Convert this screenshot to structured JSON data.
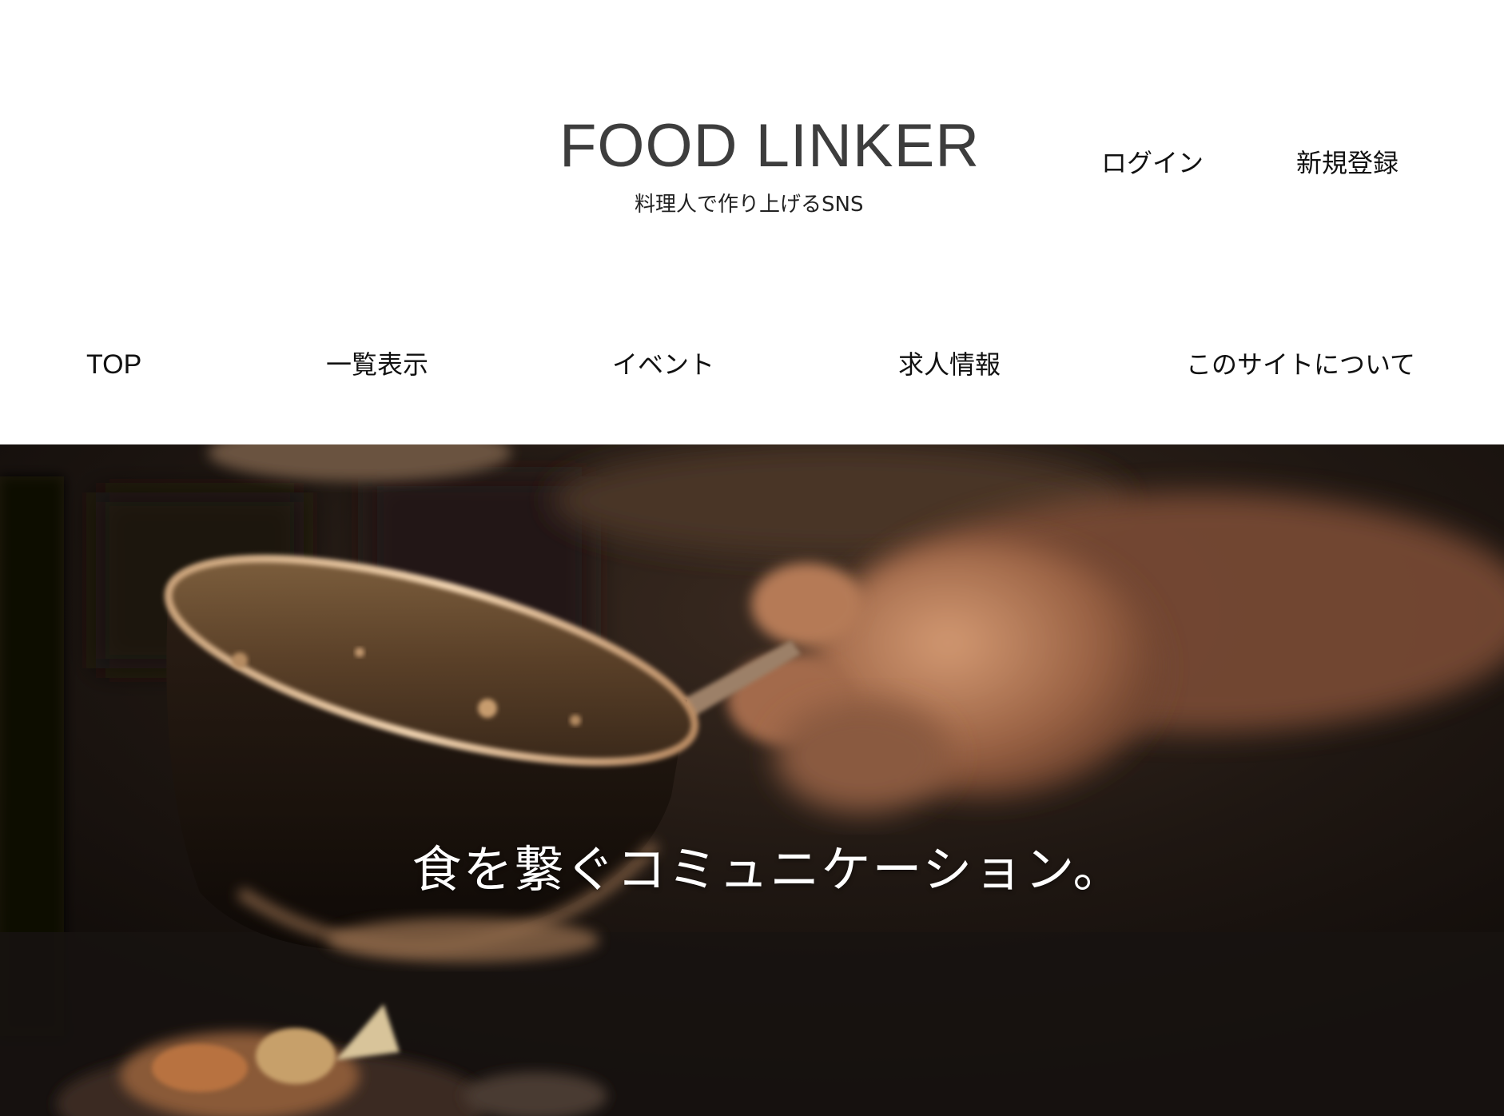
{
  "header": {
    "title": "FOOD LINKER",
    "subtitle": "料理人で作り上げるSNS",
    "login_label": "ログイン",
    "signup_label": "新規登録"
  },
  "nav": {
    "items": [
      {
        "label": "TOP"
      },
      {
        "label": "一覧表示"
      },
      {
        "label": "イベント"
      },
      {
        "label": "求人情報"
      },
      {
        "label": "このサイトについて"
      }
    ]
  },
  "hero": {
    "caption": "食を繋ぐコミュニケーション。",
    "image": "cook-holding-pan-photo"
  },
  "colors": {
    "title": "#3d3d3d",
    "text": "#111111",
    "hero_bg": "#150f0b",
    "caption": "#ffffff"
  }
}
